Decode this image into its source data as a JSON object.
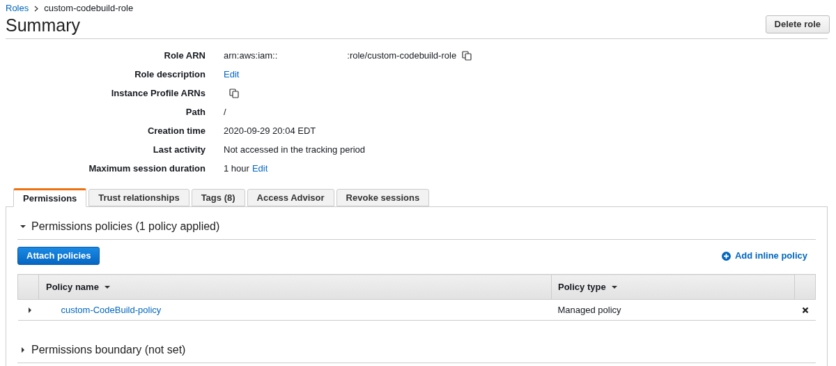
{
  "breadcrumb": [
    {
      "kind": "link",
      "text": "Roles"
    },
    {
      "kind": "current",
      "text": "custom-codebuild-role"
    }
  ],
  "title": "Summary",
  "delete_button": "Delete role",
  "details": [
    {
      "label": "Role ARN",
      "parts": [
        {
          "kind": "text",
          "text": "arn:aws:iam::"
        },
        {
          "kind": "gap"
        },
        {
          "kind": "text",
          "text": ":role/custom-codebuild-role"
        },
        {
          "kind": "copy"
        }
      ]
    },
    {
      "label": "Role description",
      "parts": [
        {
          "kind": "link",
          "text": "Edit"
        }
      ]
    },
    {
      "label": "Instance Profile ARNs",
      "parts": [
        {
          "kind": "copy"
        }
      ]
    },
    {
      "label": "Path",
      "parts": [
        {
          "kind": "text",
          "text": "/"
        }
      ]
    },
    {
      "label": "Creation time",
      "parts": [
        {
          "kind": "text",
          "text": "2020-09-29 20:04 EDT"
        }
      ]
    },
    {
      "label": "Last activity",
      "parts": [
        {
          "kind": "text",
          "text": "Not accessed in the tracking period"
        }
      ]
    },
    {
      "label": "Maximum session duration",
      "parts": [
        {
          "kind": "text",
          "text": "1 hour"
        },
        {
          "kind": "link",
          "text": "Edit"
        }
      ]
    }
  ],
  "tabs": [
    {
      "label": "Permissions",
      "selected": true
    },
    {
      "label": "Trust relationships",
      "selected": false
    },
    {
      "label": "Tags (8)",
      "selected": false
    },
    {
      "label": "Access Advisor",
      "selected": false
    },
    {
      "label": "Revoke sessions",
      "selected": false
    }
  ],
  "policies_section": {
    "title": "Permissions policies (1 policy applied)",
    "expanded": true,
    "attach_button": "Attach policies",
    "add_inline_link": "Add inline policy",
    "table": {
      "columns": [
        "Policy name",
        "Policy type"
      ],
      "rows": [
        {
          "expanded": false,
          "name": "custom-CodeBuild-policy",
          "type": "Managed policy"
        }
      ]
    }
  },
  "boundary_section": {
    "title": "Permissions boundary (not set)",
    "expanded": false
  }
}
